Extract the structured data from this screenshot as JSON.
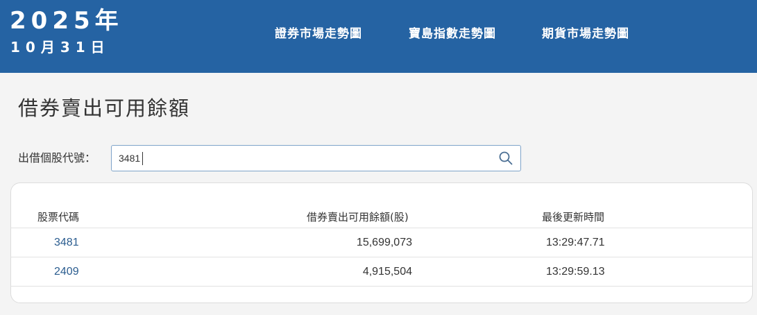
{
  "header": {
    "year": "2025年",
    "day": "10月31日",
    "nav": [
      "證券市場走勢圖",
      "寶島指數走勢圖",
      "期貨市場走勢圖"
    ]
  },
  "page": {
    "title": "借券賣出可用餘額"
  },
  "search": {
    "label": "出借個股代號：",
    "value": "3481"
  },
  "table": {
    "headers": [
      "股票代碼",
      "借券賣出可用餘額(股)",
      "最後更新時間"
    ],
    "rows": [
      {
        "code": "3481",
        "qty": "15,699,073",
        "time": "13:29:47.71"
      },
      {
        "code": "2409",
        "qty": "4,915,504",
        "time": "13:29:59.13"
      }
    ]
  },
  "colors": {
    "header_bg": "#2563a3",
    "link": "#2a5c8f",
    "page_bg": "#f4f4f4"
  }
}
